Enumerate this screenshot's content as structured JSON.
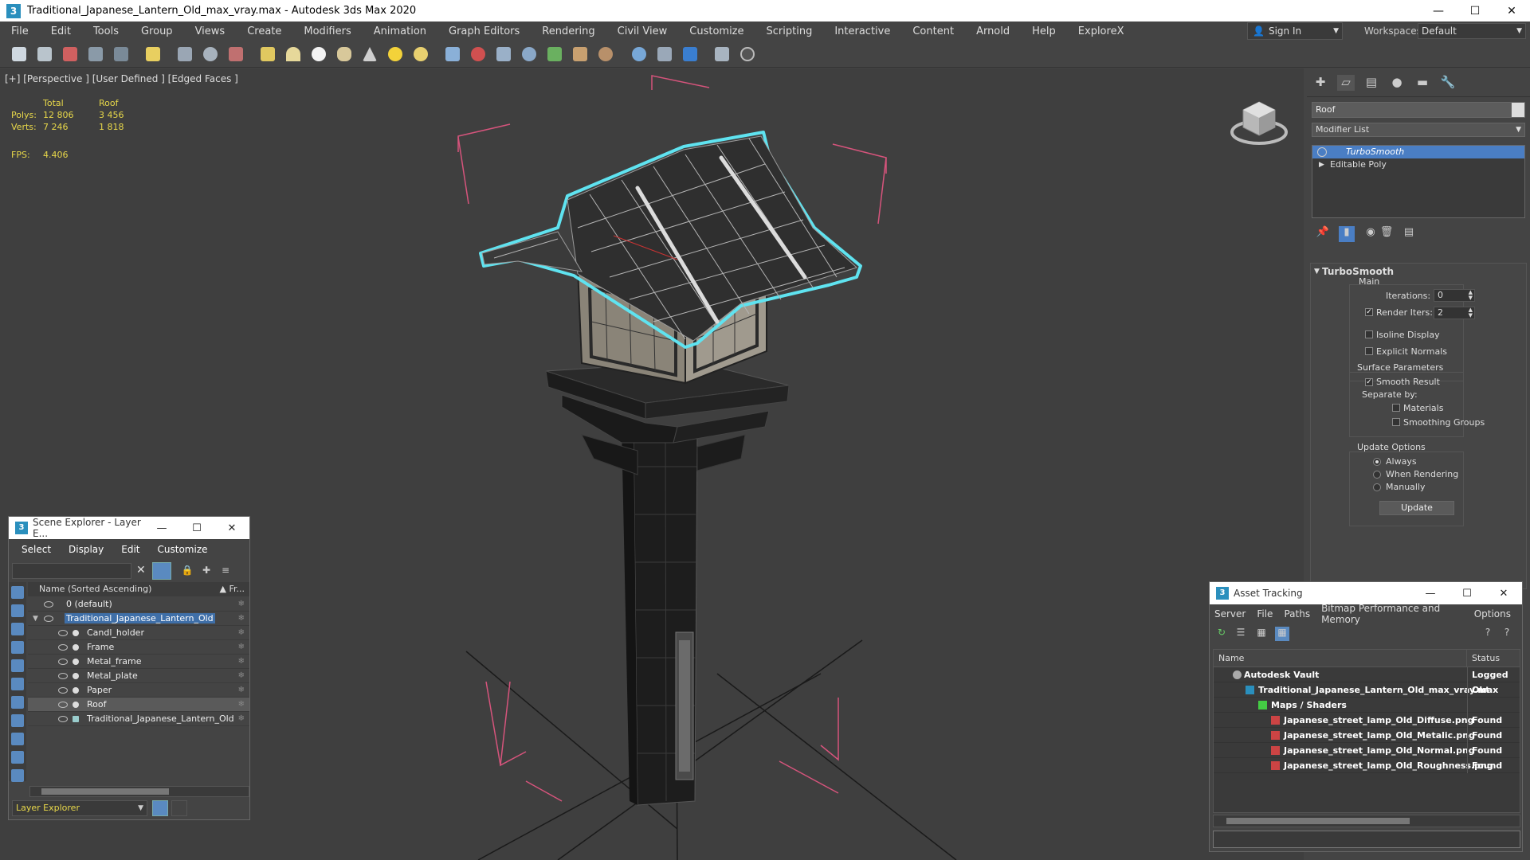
{
  "window": {
    "title": "Traditional_Japanese_Lantern_Old_max_vray.max - Autodesk 3ds Max 2020"
  },
  "menu": [
    "File",
    "Edit",
    "Tools",
    "Group",
    "Views",
    "Create",
    "Modifiers",
    "Animation",
    "Graph Editors",
    "Rendering",
    "Civil View",
    "Customize",
    "Scripting",
    "Interactive",
    "Content",
    "Arnold",
    "Help",
    "ExploreX"
  ],
  "signin": {
    "label": "Sign In"
  },
  "workspaces": {
    "label": "Workspaces:",
    "value": "Default"
  },
  "viewport": {
    "label": "[+] [Perspective ] [User Defined ] [Edged Faces ]",
    "stats": {
      "col_total": "Total",
      "col_roof": "Roof",
      "polys_label": "Polys:",
      "polys_total": "12 806",
      "polys_roof": "3 456",
      "verts_label": "Verts:",
      "verts_total": "7 246",
      "verts_roof": "1 818",
      "fps_label": "FPS:",
      "fps_value": "4.406"
    }
  },
  "scene_explorer": {
    "title": "Scene Explorer - Layer E...",
    "menu": [
      "Select",
      "Display",
      "Edit",
      "Customize"
    ],
    "column": "Name (Sorted Ascending)",
    "column_fr": "▲ Fr...",
    "rows": [
      {
        "name": "0 (default)",
        "level": 0
      },
      {
        "name": "Traditional_Japanese_Lantern_Old",
        "level": 0
      },
      {
        "name": "Candl_holder",
        "level": 1
      },
      {
        "name": "Frame",
        "level": 1
      },
      {
        "name": "Metal_frame",
        "level": 1
      },
      {
        "name": "Metal_plate",
        "level": 1
      },
      {
        "name": "Paper",
        "level": 1
      },
      {
        "name": "Roof",
        "level": 1
      },
      {
        "name": "Traditional_Japanese_Lantern_Old",
        "level": 1
      }
    ],
    "bottom_label": "Layer Explorer"
  },
  "command_panel": {
    "object_name": "Roof",
    "modifier_list": "Modifier List",
    "stack": [
      "TurboSmooth",
      "Editable Poly"
    ],
    "rollout_title": "TurboSmooth",
    "main_label": "Main",
    "iterations_label": "Iterations:",
    "iterations_value": "0",
    "render_iters_label": "Render Iters:",
    "render_iters_value": "2",
    "isoline": "Isoline Display",
    "explicit_normals": "Explicit Normals",
    "surface_params": "Surface Parameters",
    "smooth_result": "Smooth Result",
    "separate_by": "Separate by:",
    "materials": "Materials",
    "smoothing_groups": "Smoothing Groups",
    "update_options": "Update Options",
    "always": "Always",
    "when_rendering": "When Rendering",
    "manually": "Manually",
    "update_button": "Update"
  },
  "asset_tracking": {
    "title": "Asset Tracking",
    "menu": [
      "Server",
      "File",
      "Paths",
      "Bitmap Performance and Memory",
      "Options"
    ],
    "col_name": "Name",
    "col_status": "Status",
    "rows": [
      {
        "name": "Autodesk Vault",
        "status": "Logged Out"
      },
      {
        "name": "Traditional_Japanese_Lantern_Old_max_vray.max",
        "status": "Ok"
      },
      {
        "name": "Maps / Shaders",
        "status": ""
      },
      {
        "name": "Japanese_street_lamp_Old_Diffuse.png",
        "status": "Found"
      },
      {
        "name": "Japanese_street_lamp_Old_Metalic.png",
        "status": "Found"
      },
      {
        "name": "Japanese_street_lamp_Old_Normal.png",
        "status": "Found"
      },
      {
        "name": "Japanese_street_lamp_Old_Roughness.png",
        "status": "Found"
      }
    ]
  },
  "colors": {
    "accent": "#4a7ec4",
    "selection_outline": "#5fe3f0",
    "stats_yellow": "#e8d84a",
    "bbox_red": "#d6547c"
  }
}
